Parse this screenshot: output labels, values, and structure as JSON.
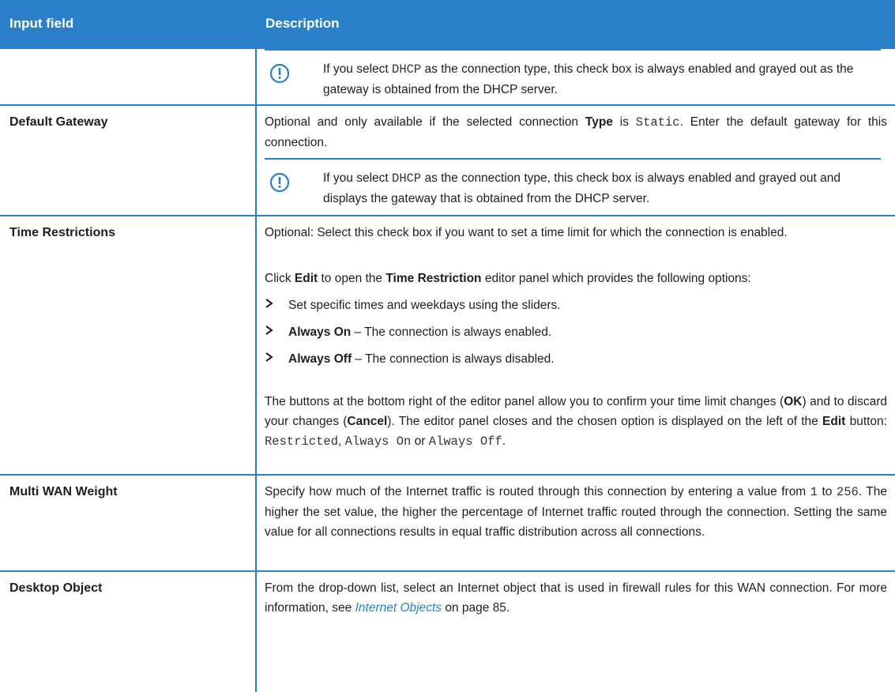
{
  "header": {
    "col1": "Input field",
    "col2": "Description"
  },
  "note1": {
    "pre": "If you select ",
    "code": "DHCP",
    "post": " as the connection type, this check box is always enabled and grayed out as the gateway is obtained from the DHCP server."
  },
  "row_gateway": {
    "label": "Default Gateway",
    "d1": "Optional and only available if the selected connection ",
    "d_b": "Type",
    "d2": " is ",
    "d_code": "Static",
    "d3": ". Enter the default gateway for this connection.",
    "note_pre": "If you select ",
    "note_code": "DHCP",
    "note_post": " as the connection type, this check box is always enabled and grayed out and displays the gateway that is obtained from the DHCP server."
  },
  "row_time": {
    "label": "Time Restrictions",
    "p1": "Optional: Select this check box if you want to set a time limit for which the connection is enabled.",
    "p2a": "Click ",
    "p2b": "Edit",
    "p2c": " to open the ",
    "p2d": "Time Restriction",
    "p2e": " editor panel which provides the following options:",
    "b1": "Set specific times and weekdays using the sliders.",
    "b2a": "Always On",
    "b2b": " – The connection is always enabled.",
    "b3a": "Always Off",
    "b3b": " – The connection is always disabled.",
    "p3a": "The buttons at the bottom right of the editor panel allow you to confirm your time limit changes (",
    "p3b": "OK",
    "p3c": ") and to discard your changes (",
    "p3d": "Cancel",
    "p3e": "). The editor panel closes and the chosen option is displayed on the left of the ",
    "p3f": "Edit",
    "p3g": " button: ",
    "p3h": "Restricted",
    "p3i": ", ",
    "p3j": "Always On",
    "p3k": " or ",
    "p3l": "Always Off",
    "p3m": "."
  },
  "row_wan": {
    "label": "Multi WAN Weight",
    "a": "Specify how much of the Internet traffic is routed through this connection by entering a value from ",
    "c1": "1",
    "b": " to ",
    "c2": "256",
    "c": ". The higher the set value, the higher the percentage of Internet traffic routed through the connection. Setting the same value for all connections results in equal traffic distribution across all connections."
  },
  "row_desktop": {
    "label": "Desktop Object",
    "a": "From the drop-down list, select an Internet object that is used in firewall rules for this WAN connection. For more information, see ",
    "link": "Internet Objects",
    "b": " on page 85."
  },
  "colors": {
    "accent": "#2a80c8",
    "header_text": "#ffffff"
  },
  "icons": {
    "note": "exclamation-circle-icon",
    "bullet": "chevron-right-icon"
  }
}
